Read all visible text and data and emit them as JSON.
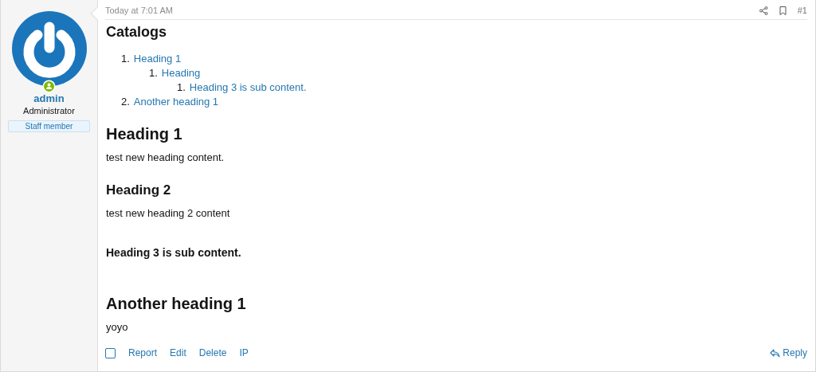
{
  "user": {
    "name": "admin",
    "title": "Administrator",
    "banner": "Staff member"
  },
  "post": {
    "time": "Today at 7:01 AM",
    "number": "#1",
    "catalog": {
      "title": "Catalogs",
      "items": [
        {
          "marker": "1.",
          "label": "Heading 1",
          "children": [
            {
              "marker": "1.",
              "label": "Heading",
              "children": [
                {
                  "marker": "1.",
                  "label": "Heading 3 is sub content."
                }
              ]
            }
          ]
        },
        {
          "marker": "2.",
          "label": "Another heading 1"
        }
      ]
    },
    "blocks": [
      {
        "kind": "h1",
        "text": "Heading 1"
      },
      {
        "kind": "p",
        "text": "test new heading content."
      },
      {
        "kind": "h2",
        "text": "Heading 2"
      },
      {
        "kind": "p",
        "text": "test new heading 2 content"
      },
      {
        "kind": "h3",
        "text": "Heading 3 is sub content."
      },
      {
        "kind": "h1",
        "text": "Another heading 1"
      },
      {
        "kind": "p",
        "text": "yoyo"
      }
    ],
    "select": {
      "checked": false
    },
    "actions": [
      "Report",
      "Edit",
      "Delete",
      "IP"
    ],
    "reply": "Reply"
  }
}
